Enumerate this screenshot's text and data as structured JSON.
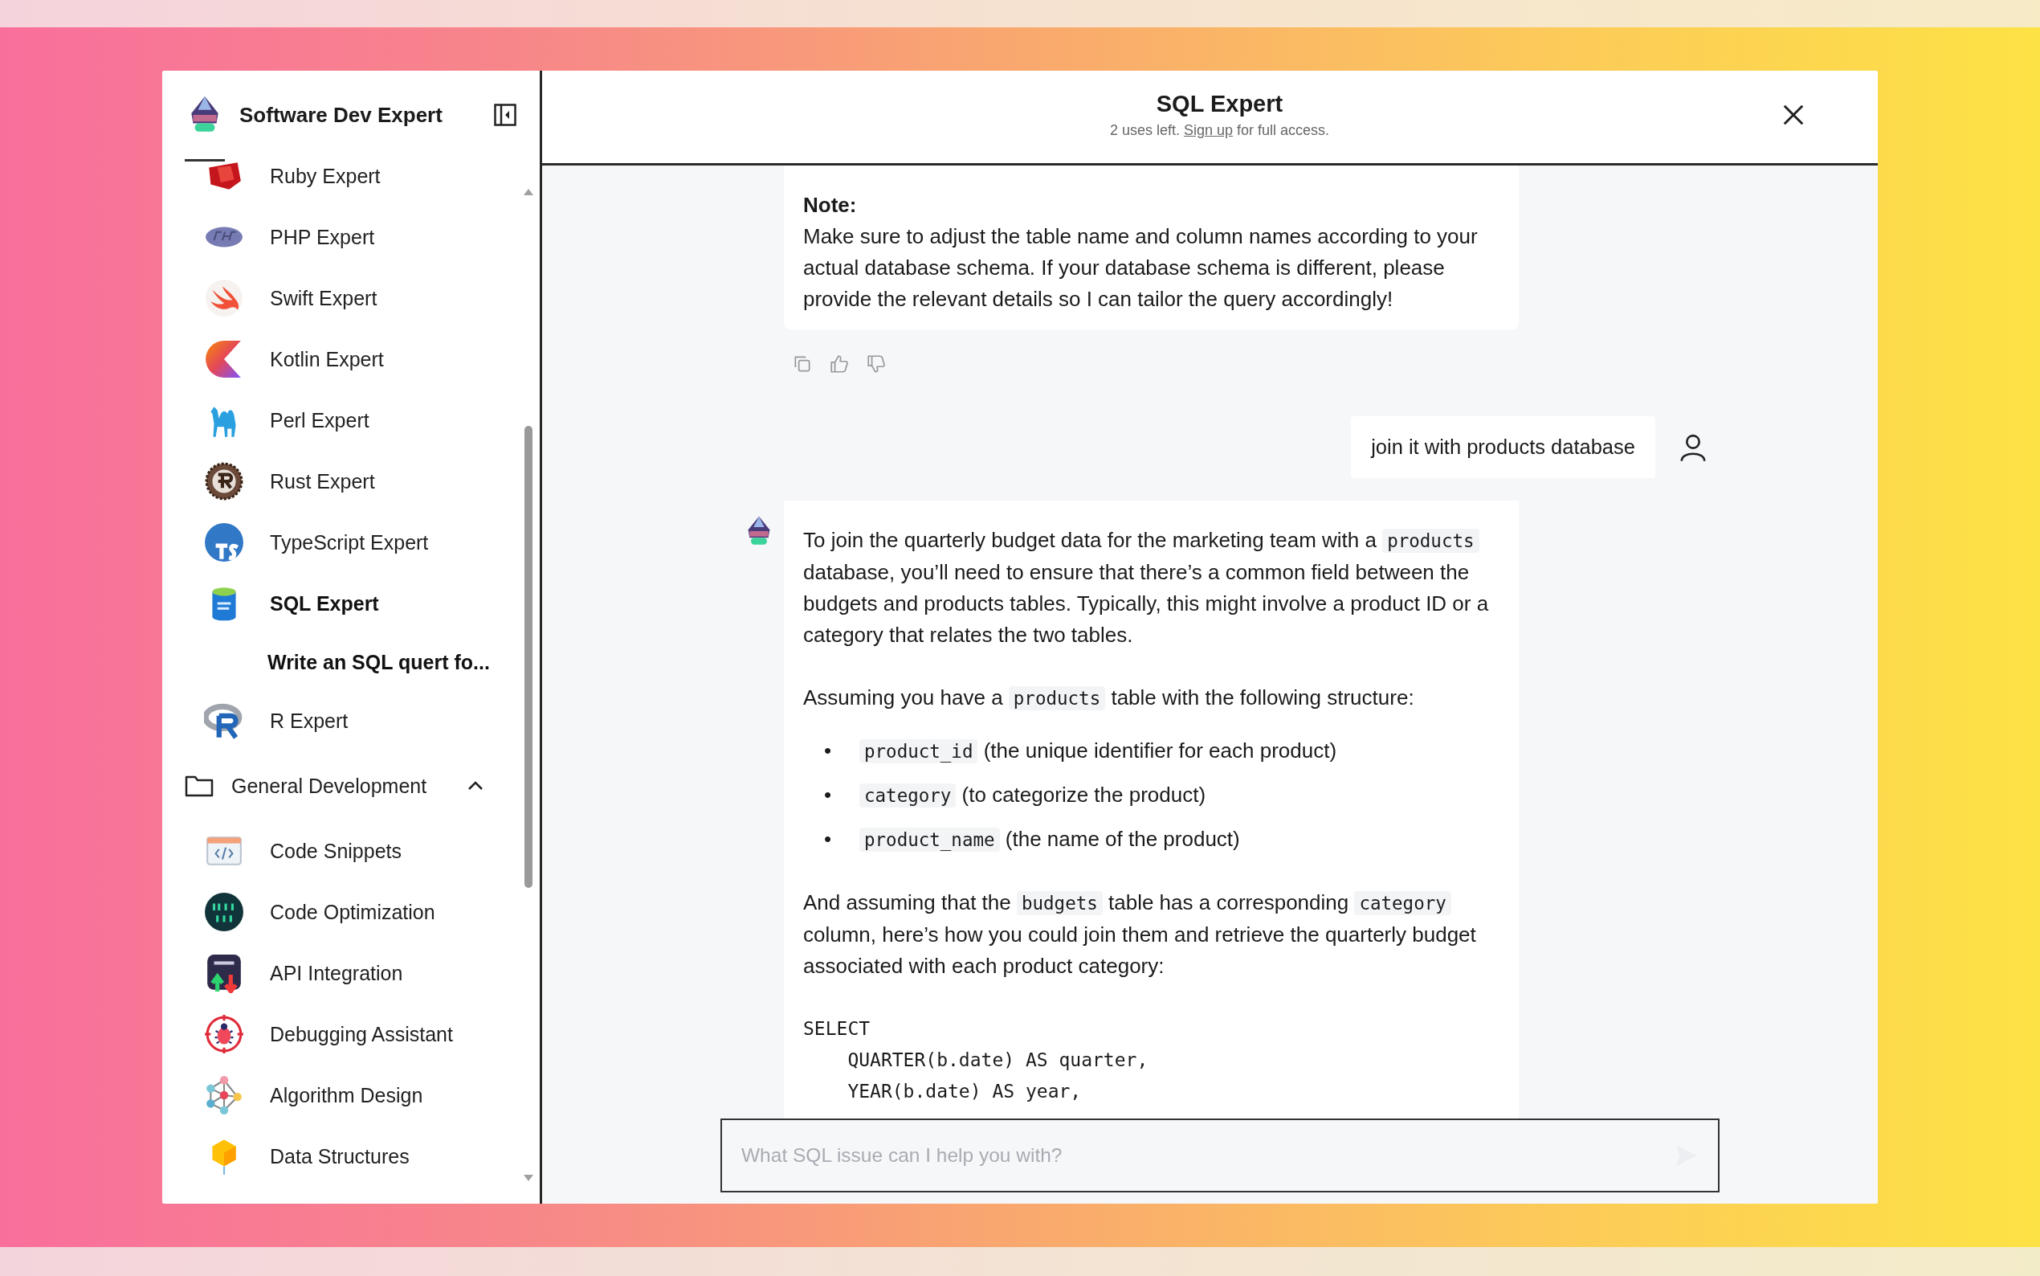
{
  "sidebar": {
    "title": "Software Dev Expert",
    "items": [
      {
        "label": "Ruby Expert",
        "selected": false
      },
      {
        "label": "PHP Expert",
        "selected": false
      },
      {
        "label": "Swift Expert",
        "selected": false
      },
      {
        "label": "Kotlin Expert",
        "selected": false
      },
      {
        "label": "Perl Expert",
        "selected": false
      },
      {
        "label": "Rust Expert",
        "selected": false
      },
      {
        "label": "TypeScript Expert",
        "selected": false
      },
      {
        "label": "SQL Expert",
        "selected": true,
        "children": [
          {
            "label": "Write an SQL quert fo...",
            "selected": true
          }
        ]
      },
      {
        "label": "R Expert",
        "selected": false
      }
    ],
    "folder": {
      "label": "General Development",
      "expanded": true,
      "children": [
        {
          "label": "Code Snippets",
          "selected": false
        },
        {
          "label": "Code Optimization",
          "selected": false
        },
        {
          "label": "API Integration",
          "selected": false
        },
        {
          "label": "Debugging Assistant",
          "selected": false
        },
        {
          "label": "Algorithm Design",
          "selected": false
        },
        {
          "label": "Data Structures",
          "selected": false
        }
      ]
    }
  },
  "chat": {
    "title": "SQL Expert",
    "usage": {
      "before": "2 uses left.",
      "link": "Sign up",
      "after": "for full access."
    },
    "messages": [
      {
        "kind": "assistant",
        "avatar": false,
        "has_actions": true,
        "blocks": [
          {
            "kind": "heading",
            "text": "Note:"
          },
          {
            "kind": "paragraph",
            "parts": [
              {
                "kind": "text",
                "text": "Make sure to adjust the table name and column names according to your actual database schema. If your database schema is different, please provide the relevant details so I can tailor the query accordingly!"
              }
            ]
          }
        ]
      },
      {
        "kind": "user",
        "text": "join it with products database"
      },
      {
        "kind": "assistant",
        "avatar": true,
        "has_actions": false,
        "blocks": [
          {
            "kind": "paragraph",
            "parts": [
              {
                "kind": "text",
                "text": "To join the quarterly budget data for the marketing team with a "
              },
              {
                "kind": "code",
                "text": "products"
              },
              {
                "kind": "text",
                "text": " database, you’ll need to ensure that there’s a common field between the budgets and products tables. Typically, this might involve a product ID or a category that relates the two tables."
              }
            ]
          },
          {
            "kind": "paragraph",
            "parts": [
              {
                "kind": "text",
                "text": "Assuming you have a "
              },
              {
                "kind": "code",
                "text": "products"
              },
              {
                "kind": "text",
                "text": " table with the following structure:"
              }
            ]
          },
          {
            "kind": "bullets",
            "items": [
              {
                "marker": "•",
                "parts": [
                  {
                    "kind": "code",
                    "text": "product_id"
                  },
                  {
                    "kind": "text",
                    "text": " (the unique identifier for each product)"
                  }
                ]
              },
              {
                "marker": "•",
                "parts": [
                  {
                    "kind": "code",
                    "text": "category"
                  },
                  {
                    "kind": "text",
                    "text": " (to categorize the product)"
                  }
                ]
              },
              {
                "marker": "•",
                "parts": [
                  {
                    "kind": "code",
                    "text": "product_name"
                  },
                  {
                    "kind": "text",
                    "text": " (the name of the product)"
                  }
                ]
              }
            ]
          },
          {
            "kind": "paragraph",
            "parts": [
              {
                "kind": "text",
                "text": "And assuming that the "
              },
              {
                "kind": "code",
                "text": "budgets"
              },
              {
                "kind": "text",
                "text": " table has a corresponding "
              },
              {
                "kind": "code",
                "text": "category"
              },
              {
                "kind": "text",
                "text": " column, here’s how you could join them and retrieve the quarterly budget associated with each product category:"
              }
            ]
          },
          {
            "kind": "code",
            "lines": [
              "SELECT",
              "    QUARTER(b.date) AS quarter,",
              "    YEAR(b.date) AS year,"
            ]
          }
        ]
      }
    ]
  },
  "input": {
    "placeholder": "What SQL issue can I help you with?"
  }
}
